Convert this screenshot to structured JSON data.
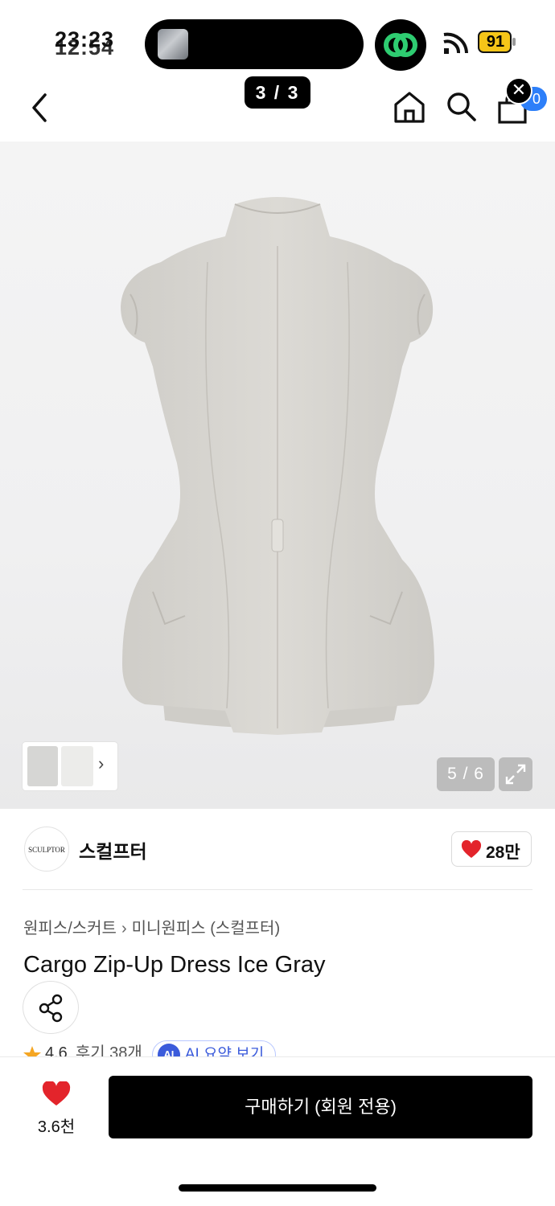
{
  "status_bar": {
    "time_primary": "23:23",
    "time_secondary": "12:54",
    "battery": "91",
    "icons": [
      "wifi-icon",
      "battery-icon",
      "link-icon"
    ],
    "accent_green": "#2ecc71"
  },
  "nav": {
    "pager": "3 / 3",
    "cart_badge": "0",
    "icons": [
      "back-icon",
      "home-icon",
      "search-icon",
      "cart-icon",
      "close-icon"
    ]
  },
  "gallery": {
    "counter": "5 / 6",
    "thumb_arrow": "›",
    "icons": [
      "expand-icon",
      "chevron-right-icon"
    ]
  },
  "brand": {
    "logo_text": "SCULPTOR",
    "name": "스컬프터",
    "likes": "28만",
    "heart_color": "#e3242b"
  },
  "product": {
    "breadcrumb": [
      "원피스/스커트",
      "미니원피스 (스컬프터)"
    ],
    "breadcrumb_sep": "›",
    "title": "Cargo Zip-Up Dress Ice Gray",
    "rating": "4.6",
    "reviews": "후기 38개",
    "ai_badge": "AI",
    "ai_summary": "AI 요약 보기"
  },
  "bottom": {
    "wish_count": "3.6천",
    "buy_label": "구매하기 (회원 전용)"
  }
}
